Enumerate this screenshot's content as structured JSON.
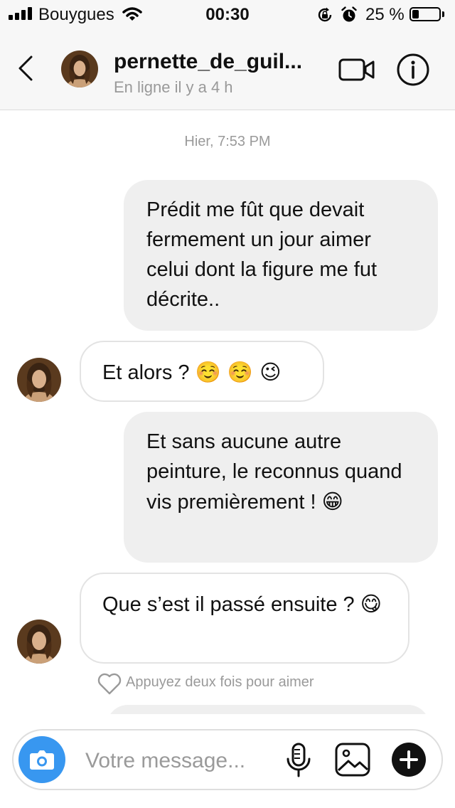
{
  "status_bar": {
    "carrier": "Bouygues",
    "time": "00:30",
    "battery_percent": "25 %",
    "battery_level": 0.25,
    "icons": [
      "signal-icon",
      "wifi-icon",
      "rotation-lock-icon",
      "alarm-icon",
      "battery-icon"
    ]
  },
  "header": {
    "username": "pernette_de_guil...",
    "status": "En ligne il y a 4 h",
    "icons": [
      "chevron-left-icon",
      "video-camera-icon",
      "info-icon"
    ]
  },
  "thread": {
    "timestamp": "Hier, 7:53 PM",
    "messages": [
      {
        "direction": "outgoing",
        "text": "Prédit me fût que devait fermement un jour aimer celui dont la figure me fut décrite..",
        "emoji": ""
      },
      {
        "direction": "incoming",
        "text": "Et alors ? ",
        "emoji": "☺️ ☺️ 😉"
      },
      {
        "direction": "outgoing",
        "text": "Et sans aucune autre peinture, le reconnus quand vis premièrement ! ",
        "emoji": "😁"
      },
      {
        "direction": "incoming",
        "text": "Que s’est il passé ensuite ? ",
        "emoji": "😋"
      }
    ],
    "like_hint": "Appuyez deux fois pour aimer"
  },
  "composer": {
    "placeholder": "Votre message...",
    "icons": [
      "camera-icon",
      "microphone-icon",
      "gallery-icon",
      "plus-icon"
    ]
  },
  "colors": {
    "accent": "#3897f0",
    "outgoing_bubble": "#efefef",
    "incoming_border": "#e3e3e3",
    "secondary_text": "#9a9a9a"
  }
}
